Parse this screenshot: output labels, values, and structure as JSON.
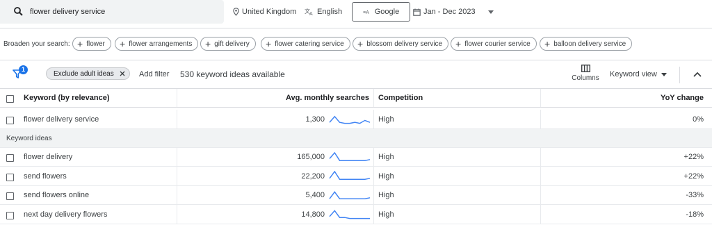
{
  "top_bar": {
    "search_value": "flower delivery service",
    "location": "United Kingdom",
    "language": "English",
    "search_engine": "Google",
    "date_range": "Jan - Dec 2023"
  },
  "broaden": {
    "label": "Broaden your search:",
    "chips": [
      "flower",
      "flower arrangements",
      "gift delivery",
      "flower catering service",
      "blossom delivery service",
      "flower courier service",
      "balloon delivery service"
    ]
  },
  "filters": {
    "badge_count": "1",
    "active_filter": "Exclude adult ideas",
    "add_filter_label": "Add filter",
    "ideas_count": "530 keyword ideas available",
    "columns_label": "Columns",
    "view_label": "Keyword view"
  },
  "table": {
    "headers": {
      "keyword": "Keyword (by relevance)",
      "avg": "Avg. monthly searches",
      "competition": "Competition",
      "yoy": "YoY change"
    },
    "provided": [
      {
        "keyword": "flower delivery service",
        "avg": "1,300",
        "competition": "High",
        "yoy": "0%",
        "trend": [
          2,
          8,
          2,
          1,
          1,
          2,
          1,
          4,
          2
        ]
      }
    ],
    "section_label": "Keyword ideas",
    "ideas": [
      {
        "keyword": "flower delivery",
        "avg": "165,000",
        "competition": "High",
        "yoy": "+22%",
        "trend": [
          4,
          10,
          2,
          2,
          2,
          2,
          2,
          2,
          3
        ]
      },
      {
        "keyword": "send flowers",
        "avg": "22,200",
        "competition": "High",
        "yoy": "+22%",
        "trend": [
          3,
          10,
          2,
          2,
          2,
          2,
          2,
          2,
          3
        ]
      },
      {
        "keyword": "send flowers online",
        "avg": "5,400",
        "competition": "High",
        "yoy": "-33%",
        "trend": [
          2,
          9,
          2,
          2,
          2,
          2,
          2,
          2,
          3
        ]
      },
      {
        "keyword": "next day delivery flowers",
        "avg": "14,800",
        "competition": "High",
        "yoy": "-18%",
        "trend": [
          3,
          9,
          2,
          2,
          1,
          1,
          1,
          1,
          1
        ]
      }
    ]
  },
  "colors": {
    "accent": "#1a73e8",
    "sparkline": "#4285f4"
  }
}
